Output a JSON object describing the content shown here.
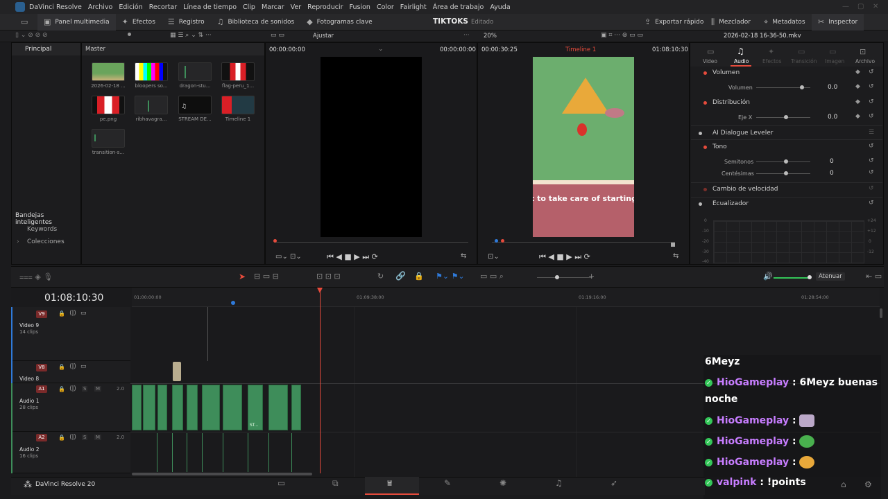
{
  "app": {
    "menu": [
      "DaVinci Resolve",
      "Archivo",
      "Edición",
      "Recortar",
      "Línea de tiempo",
      "Clip",
      "Marcar",
      "Ver",
      "Reproducir",
      "Fusion",
      "Color",
      "Fairlight",
      "Área de trabajo",
      "Ayuda"
    ],
    "project_title": "TIKTOKS",
    "project_status": "Editado",
    "footer_label": "DaVinci Resolve 20"
  },
  "toolbar": {
    "media_pool": "Panel multimedia",
    "effects": "Efectos",
    "edit_index": "Registro",
    "sound_library": "Biblioteca de sonidos",
    "keyframes": "Fotogramas clave",
    "quick_export": "Exportar rápido",
    "mixer": "Mezclador",
    "metadata": "Metadatos",
    "inspector": "Inspector"
  },
  "subbar": {
    "fit": "Ajustar",
    "zoom": "20%",
    "clip_name": "2026-02-18 16-36-50.mkv"
  },
  "media_pool": {
    "sidebar_header": "Principal",
    "bin_header": "Master",
    "smart_bins": "Bandejas inteligentes",
    "keywords": "Keywords",
    "collections": "Colecciones",
    "items": [
      {
        "label": "2026-02-18 ..."
      },
      {
        "label": "bloopers so..."
      },
      {
        "label": "dragon-stu..."
      },
      {
        "label": "flag-peru_1..."
      },
      {
        "label": "pe.png"
      },
      {
        "label": "ribhavagra..."
      },
      {
        "label": "STREAM DE..."
      },
      {
        "label": "Timeline 1"
      },
      {
        "label": "transition-s..."
      }
    ]
  },
  "viewer": {
    "source_tc_left": "00:00:00:00",
    "source_tc_right": "00:00:00:00",
    "program_tc_left": "00:00:30:25",
    "timeline_name": "Timeline 1",
    "program_tc_right": "01:08:10:30",
    "caption": "t to take care of starting"
  },
  "inspector": {
    "tabs": [
      "Video",
      "Audio",
      "Efectos",
      "Transición",
      "Imagen",
      "Archivo"
    ],
    "volume_section": "Volumen",
    "volume_label": "Volumen",
    "volume_value": "0.0",
    "pan_section": "Distribución",
    "pan_label": "Eje X",
    "pan_value": "0.0",
    "dialogue_leveler": "AI Dialogue Leveler",
    "pitch_section": "Tono",
    "semitones_label": "Semitonos",
    "semitones_value": "0",
    "cents_label": "Centésimas",
    "cents_value": "0",
    "speed_change": "Cambio de velocidad",
    "equalizer": "Ecualizador",
    "eq_left_ticks": [
      "0",
      "-10",
      "-20",
      "-30",
      "-40"
    ],
    "eq_right_ticks": [
      "+24",
      "+12",
      "0",
      "-12"
    ]
  },
  "timeline": {
    "timecode": "01:08:10:30",
    "ruler": [
      "01:00:00:00",
      "01:09:38:00",
      "01:19:16:00",
      "01:28:54:00"
    ],
    "attenuate": "Atenuar",
    "tracks": [
      {
        "tag": "V9",
        "name": "Video 9",
        "clips": "14 clips"
      },
      {
        "tag": "V8",
        "name": "Video 8",
        "clips": ""
      },
      {
        "tag": "A1",
        "name": "Audio 1",
        "clips": "28 clips",
        "level": "2.0"
      },
      {
        "tag": "A2",
        "name": "Audio 2",
        "clips": "16 clips",
        "level": "2.0"
      }
    ],
    "solo": "S",
    "mute": "M",
    "clip_label": "ST..."
  },
  "chat": {
    "lines": [
      {
        "user": "6Meyz",
        "text": ""
      },
      {
        "user": "HioGameplay",
        "text": " : 6Meyz buenas"
      },
      {
        "user": "",
        "text": "noche"
      },
      {
        "user": "HioGameplay",
        "text": " :"
      },
      {
        "user": "HioGameplay",
        "text": " :"
      },
      {
        "user": "HioGameplay",
        "text": " :"
      },
      {
        "user": "valpink",
        "text": " : !points"
      }
    ]
  },
  "colors": {
    "accent_red": "#e64b3c",
    "audio_clip": "#3e8d5a",
    "chat_user": "#c77dff",
    "panel_bg": "#1c1c1e"
  }
}
